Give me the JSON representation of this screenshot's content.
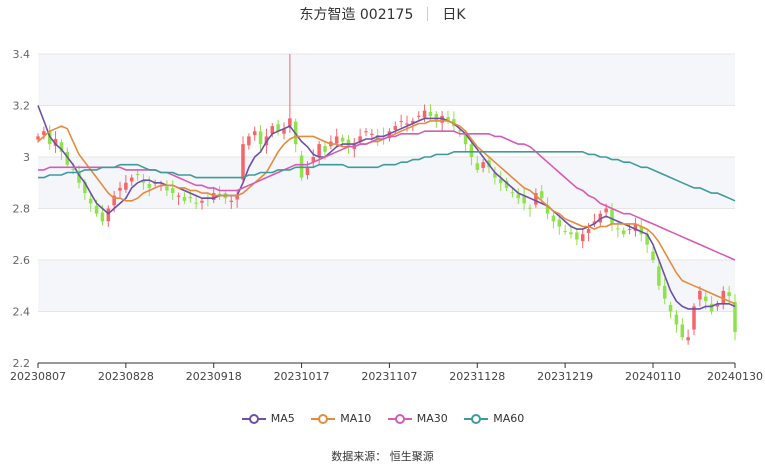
{
  "header": {
    "stock": "东方智造 002175",
    "period": "日K"
  },
  "source": {
    "label": "数据来源：",
    "provider": "恒生聚源"
  },
  "colors": {
    "up": "#f6646a",
    "down": "#8fe34a",
    "MA5": "#6d4fa8",
    "MA10": "#e58b3e",
    "MA30": "#d75bb3",
    "MA60": "#3f9b9b",
    "grid": "#e6e6e6",
    "band": "#f5f6fa"
  },
  "chart_data": {
    "type": "candlestick",
    "ylim": [
      2.2,
      3.4
    ],
    "yticks": [
      2.2,
      2.4,
      2.6,
      2.8,
      3.0,
      3.2,
      3.4
    ],
    "ytick_labels": [
      "2.2",
      "2.4",
      "2.6",
      "2.8",
      "3",
      "3.2",
      "3.4"
    ],
    "xticks": [
      {
        "index": 0,
        "label": "20230807"
      },
      {
        "index": 15,
        "label": "20230828"
      },
      {
        "index": 30,
        "label": "20230918"
      },
      {
        "index": 45,
        "label": "20231017"
      },
      {
        "index": 60,
        "label": "20231107"
      },
      {
        "index": 75,
        "label": "20231128"
      },
      {
        "index": 90,
        "label": "20231219"
      },
      {
        "index": 105,
        "label": "20240110"
      },
      {
        "index": 119,
        "label": "20240130"
      }
    ],
    "close": [
      3.08,
      3.1,
      3.05,
      3.07,
      3.02,
      2.97,
      2.95,
      2.9,
      2.86,
      2.82,
      2.78,
      2.75,
      2.8,
      2.85,
      2.88,
      2.9,
      2.92,
      2.93,
      2.9,
      2.88,
      2.9,
      2.89,
      2.87,
      2.86,
      2.85,
      2.83,
      2.84,
      2.82,
      2.83,
      2.84,
      2.86,
      2.85,
      2.84,
      2.83,
      2.85,
      3.05,
      3.08,
      3.1,
      3.05,
      3.08,
      3.12,
      3.1,
      3.11,
      3.15,
      3.05,
      2.92,
      2.96,
      3.0,
      3.05,
      3.02,
      3.06,
      3.08,
      3.06,
      3.04,
      3.05,
      3.08,
      3.1,
      3.09,
      3.07,
      3.08,
      3.1,
      3.12,
      3.14,
      3.13,
      3.14,
      3.16,
      3.18,
      3.16,
      3.14,
      3.16,
      3.14,
      3.12,
      3.1,
      3.05,
      3.0,
      2.95,
      2.98,
      2.96,
      2.92,
      2.9,
      2.88,
      2.86,
      2.84,
      2.82,
      2.8,
      2.86,
      2.84,
      2.78,
      2.75,
      2.73,
      2.71,
      2.7,
      2.68,
      2.7,
      2.72,
      2.75,
      2.78,
      2.8,
      2.74,
      2.72,
      2.7,
      2.72,
      2.74,
      2.7,
      2.66,
      2.6,
      2.5,
      2.45,
      2.4,
      2.35,
      2.3,
      2.3,
      2.42,
      2.48,
      2.44,
      2.4,
      2.43,
      2.48,
      2.46,
      2.32
    ],
    "MA5": [
      3.2,
      3.14,
      3.08,
      3.05,
      3.03,
      3.0,
      2.97,
      2.93,
      2.9,
      2.86,
      2.82,
      2.8,
      2.78,
      2.8,
      2.82,
      2.84,
      2.88,
      2.9,
      2.91,
      2.91,
      2.9,
      2.9,
      2.89,
      2.89,
      2.88,
      2.87,
      2.86,
      2.85,
      2.84,
      2.84,
      2.84,
      2.85,
      2.85,
      2.85,
      2.85,
      2.9,
      2.96,
      3.0,
      3.02,
      3.06,
      3.09,
      3.1,
      3.11,
      3.12,
      3.09,
      3.06,
      3.04,
      3.01,
      3.0,
      3.0,
      3.02,
      3.04,
      3.05,
      3.05,
      3.05,
      3.06,
      3.07,
      3.07,
      3.08,
      3.08,
      3.09,
      3.1,
      3.11,
      3.12,
      3.13,
      3.14,
      3.15,
      3.15,
      3.15,
      3.15,
      3.14,
      3.13,
      3.11,
      3.09,
      3.06,
      3.03,
      3.0,
      2.97,
      2.94,
      2.92,
      2.9,
      2.88,
      2.86,
      2.85,
      2.84,
      2.83,
      2.82,
      2.81,
      2.79,
      2.77,
      2.75,
      2.73,
      2.72,
      2.72,
      2.73,
      2.74,
      2.76,
      2.77,
      2.76,
      2.75,
      2.74,
      2.73,
      2.72,
      2.71,
      2.7,
      2.66,
      2.6,
      2.54,
      2.48,
      2.44,
      2.42,
      2.41,
      2.41,
      2.41,
      2.42,
      2.42,
      2.43,
      2.43,
      2.43,
      2.42
    ],
    "MA10": [
      3.06,
      3.08,
      3.1,
      3.11,
      3.12,
      3.11,
      3.06,
      3.01,
      2.98,
      2.95,
      2.92,
      2.89,
      2.86,
      2.84,
      2.84,
      2.83,
      2.83,
      2.84,
      2.86,
      2.87,
      2.88,
      2.89,
      2.89,
      2.89,
      2.88,
      2.88,
      2.87,
      2.87,
      2.86,
      2.86,
      2.85,
      2.85,
      2.85,
      2.85,
      2.85,
      2.86,
      2.88,
      2.9,
      2.92,
      2.94,
      2.98,
      3.02,
      3.05,
      3.07,
      3.08,
      3.08,
      3.08,
      3.08,
      3.07,
      3.06,
      3.05,
      3.05,
      3.04,
      3.04,
      3.04,
      3.05,
      3.05,
      3.06,
      3.06,
      3.07,
      3.08,
      3.09,
      3.1,
      3.11,
      3.12,
      3.13,
      3.13,
      3.14,
      3.14,
      3.14,
      3.14,
      3.13,
      3.12,
      3.1,
      3.07,
      3.04,
      3.02,
      3.0,
      2.98,
      2.96,
      2.94,
      2.92,
      2.9,
      2.88,
      2.87,
      2.85,
      2.83,
      2.81,
      2.79,
      2.78,
      2.76,
      2.75,
      2.74,
      2.73,
      2.73,
      2.72,
      2.73,
      2.73,
      2.74,
      2.74,
      2.74,
      2.74,
      2.74,
      2.73,
      2.72,
      2.7,
      2.67,
      2.63,
      2.59,
      2.55,
      2.52,
      2.51,
      2.5,
      2.49,
      2.48,
      2.47,
      2.46,
      2.45,
      2.44,
      2.43
    ],
    "MA30": [
      2.95,
      2.95,
      2.96,
      2.96,
      2.96,
      2.96,
      2.96,
      2.96,
      2.96,
      2.96,
      2.96,
      2.96,
      2.96,
      2.96,
      2.96,
      2.95,
      2.95,
      2.95,
      2.95,
      2.95,
      2.95,
      2.94,
      2.94,
      2.93,
      2.92,
      2.91,
      2.9,
      2.89,
      2.89,
      2.88,
      2.88,
      2.87,
      2.87,
      2.87,
      2.87,
      2.88,
      2.89,
      2.9,
      2.91,
      2.92,
      2.93,
      2.94,
      2.95,
      2.96,
      2.97,
      2.97,
      2.97,
      2.98,
      2.99,
      3.0,
      3.01,
      3.02,
      3.03,
      3.04,
      3.04,
      3.05,
      3.05,
      3.06,
      3.07,
      3.07,
      3.08,
      3.08,
      3.09,
      3.09,
      3.09,
      3.09,
      3.1,
      3.1,
      3.1,
      3.1,
      3.1,
      3.1,
      3.09,
      3.09,
      3.09,
      3.09,
      3.09,
      3.09,
      3.08,
      3.08,
      3.07,
      3.06,
      3.05,
      3.05,
      3.04,
      3.02,
      3.0,
      2.98,
      2.96,
      2.94,
      2.92,
      2.9,
      2.88,
      2.87,
      2.85,
      2.84,
      2.82,
      2.81,
      2.8,
      2.79,
      2.78,
      2.78,
      2.77,
      2.76,
      2.75,
      2.74,
      2.73,
      2.72,
      2.71,
      2.7,
      2.69,
      2.68,
      2.67,
      2.66,
      2.65,
      2.64,
      2.63,
      2.62,
      2.61,
      2.6
    ],
    "MA60": [
      2.92,
      2.92,
      2.93,
      2.93,
      2.93,
      2.94,
      2.94,
      2.94,
      2.95,
      2.95,
      2.95,
      2.96,
      2.96,
      2.96,
      2.97,
      2.97,
      2.97,
      2.97,
      2.96,
      2.95,
      2.95,
      2.94,
      2.94,
      2.94,
      2.93,
      2.93,
      2.93,
      2.92,
      2.92,
      2.92,
      2.92,
      2.92,
      2.92,
      2.92,
      2.92,
      2.92,
      2.93,
      2.93,
      2.94,
      2.94,
      2.94,
      2.95,
      2.95,
      2.95,
      2.96,
      2.96,
      2.96,
      2.96,
      2.97,
      2.97,
      2.97,
      2.97,
      2.97,
      2.96,
      2.96,
      2.96,
      2.96,
      2.96,
      2.96,
      2.97,
      2.97,
      2.97,
      2.98,
      2.98,
      2.99,
      2.99,
      3.0,
      3.0,
      3.01,
      3.01,
      3.01,
      3.02,
      3.02,
      3.02,
      3.02,
      3.02,
      3.02,
      3.02,
      3.02,
      3.02,
      3.02,
      3.02,
      3.02,
      3.02,
      3.02,
      3.02,
      3.02,
      3.02,
      3.02,
      3.02,
      3.02,
      3.02,
      3.02,
      3.02,
      3.01,
      3.01,
      3.0,
      3.0,
      2.99,
      2.99,
      2.98,
      2.98,
      2.97,
      2.96,
      2.96,
      2.95,
      2.94,
      2.93,
      2.92,
      2.91,
      2.9,
      2.89,
      2.88,
      2.88,
      2.87,
      2.86,
      2.86,
      2.85,
      2.84,
      2.83
    ],
    "legend": [
      "MA5",
      "MA10",
      "MA30",
      "MA60"
    ],
    "grid": true,
    "legend_position": "bottom"
  }
}
